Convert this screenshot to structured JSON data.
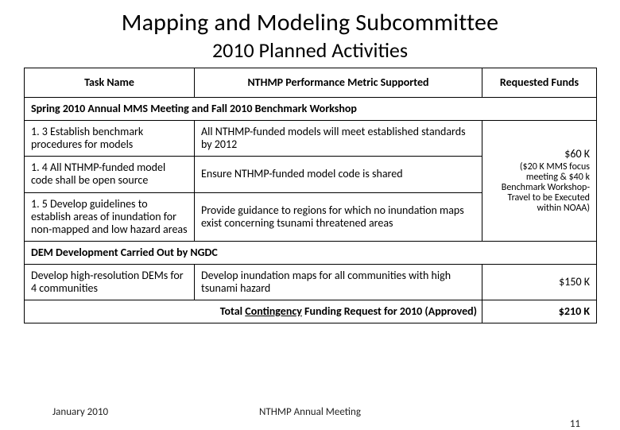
{
  "title": "Mapping and Modeling Subcommittee",
  "subtitle": "2010 Planned Activities",
  "headers": {
    "task": "Task Name",
    "metric": "NTHMP Performance Metric Supported",
    "funds": "Requested Funds"
  },
  "section1": {
    "heading": "Spring 2010 Annual MMS Meeting and Fall 2010 Benchmark Workshop",
    "rows": [
      {
        "task": "1. 3 Establish benchmark procedures for models",
        "metric": "All NTHMP-funded models will meet established standards by 2012"
      },
      {
        "task": "1. 4 All NTHMP-funded model code shall be open source",
        "metric": "Ensure NTHMP-funded model code is shared"
      },
      {
        "task": "1. 5 Develop guidelines to establish areas of inundation for non-mapped and low hazard areas",
        "metric": "Provide guidance to regions for which no inundation maps exist concerning tsunami threatened areas"
      }
    ],
    "funds_amount": "$60 K",
    "funds_note": "($20 K MMS focus meeting & $40 k Benchmark Workshop- Travel to be Executed within NOAA)"
  },
  "section2": {
    "heading": "DEM Development Carried Out by NGDC",
    "rows": [
      {
        "task": "Develop high-resolution DEMs for 4 communities",
        "metric": "Develop inundation maps for all communities with high tsunami hazard",
        "funds": "$150 K"
      }
    ]
  },
  "total": {
    "pre": "Total ",
    "mid": "Contingency",
    "post": " Funding Request for 2010 (Approved)",
    "amount": "$210 K"
  },
  "footer": {
    "left": "January 2010",
    "center": "NTHMP Annual Meeting",
    "right": "11"
  }
}
